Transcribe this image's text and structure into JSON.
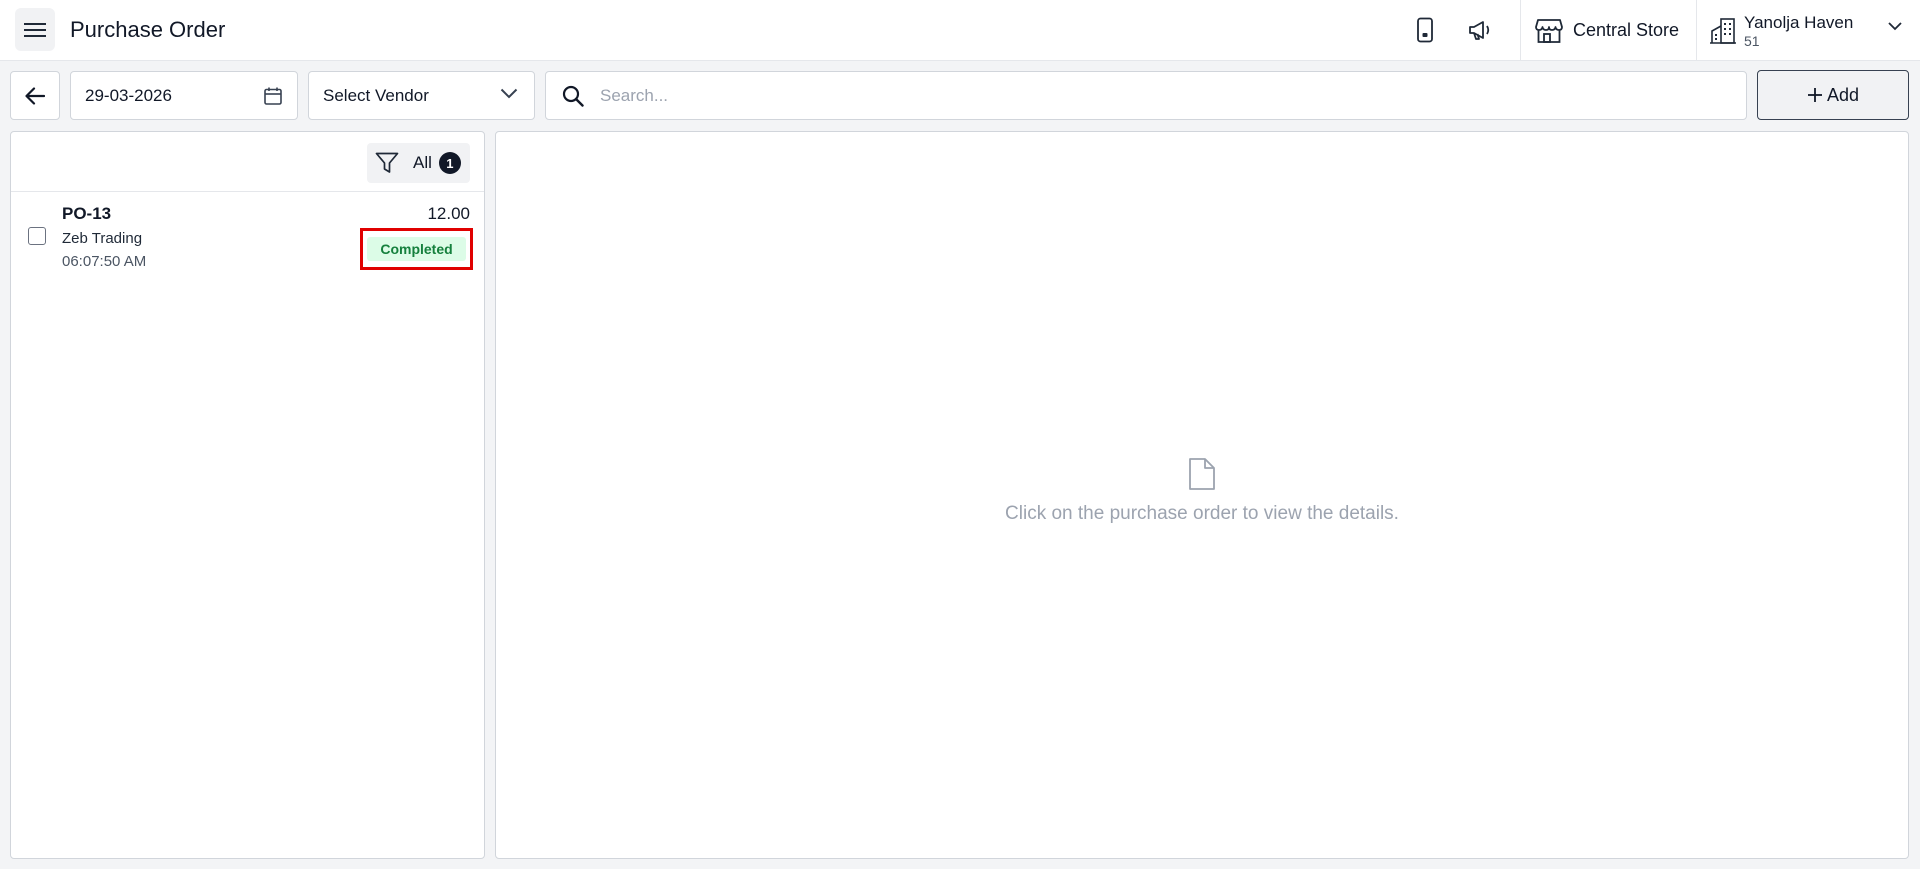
{
  "header": {
    "title": "Purchase Order",
    "store": "Central Store",
    "user_name": "Yanolja Haven",
    "user_sub": "51"
  },
  "icons": {
    "menu": "hamburger-icon",
    "device": "mobile-phone-icon",
    "announce": "megaphone-icon",
    "store": "storefront-icon",
    "building": "building-icon",
    "back": "arrow-left-icon",
    "calendar": "calendar-icon",
    "search": "search-icon",
    "filter": "filter-icon",
    "document": "document-icon"
  },
  "toolbar": {
    "date": "29-03-2026",
    "vendor_placeholder": "Select Vendor",
    "search_placeholder": "Search...",
    "add_label": "Add"
  },
  "filter": {
    "label": "All",
    "count": "1"
  },
  "orders": [
    {
      "id": "PO-13",
      "vendor": "Zeb Trading",
      "time": "06:07:50 AM",
      "amount": "12.00",
      "status": "Completed"
    }
  ],
  "detail": {
    "empty_message": "Click on the purchase order to view the details."
  },
  "colors": {
    "status_completed_bg": "#dcfce7",
    "status_completed_text": "#15803d",
    "highlight": "#e00000"
  }
}
